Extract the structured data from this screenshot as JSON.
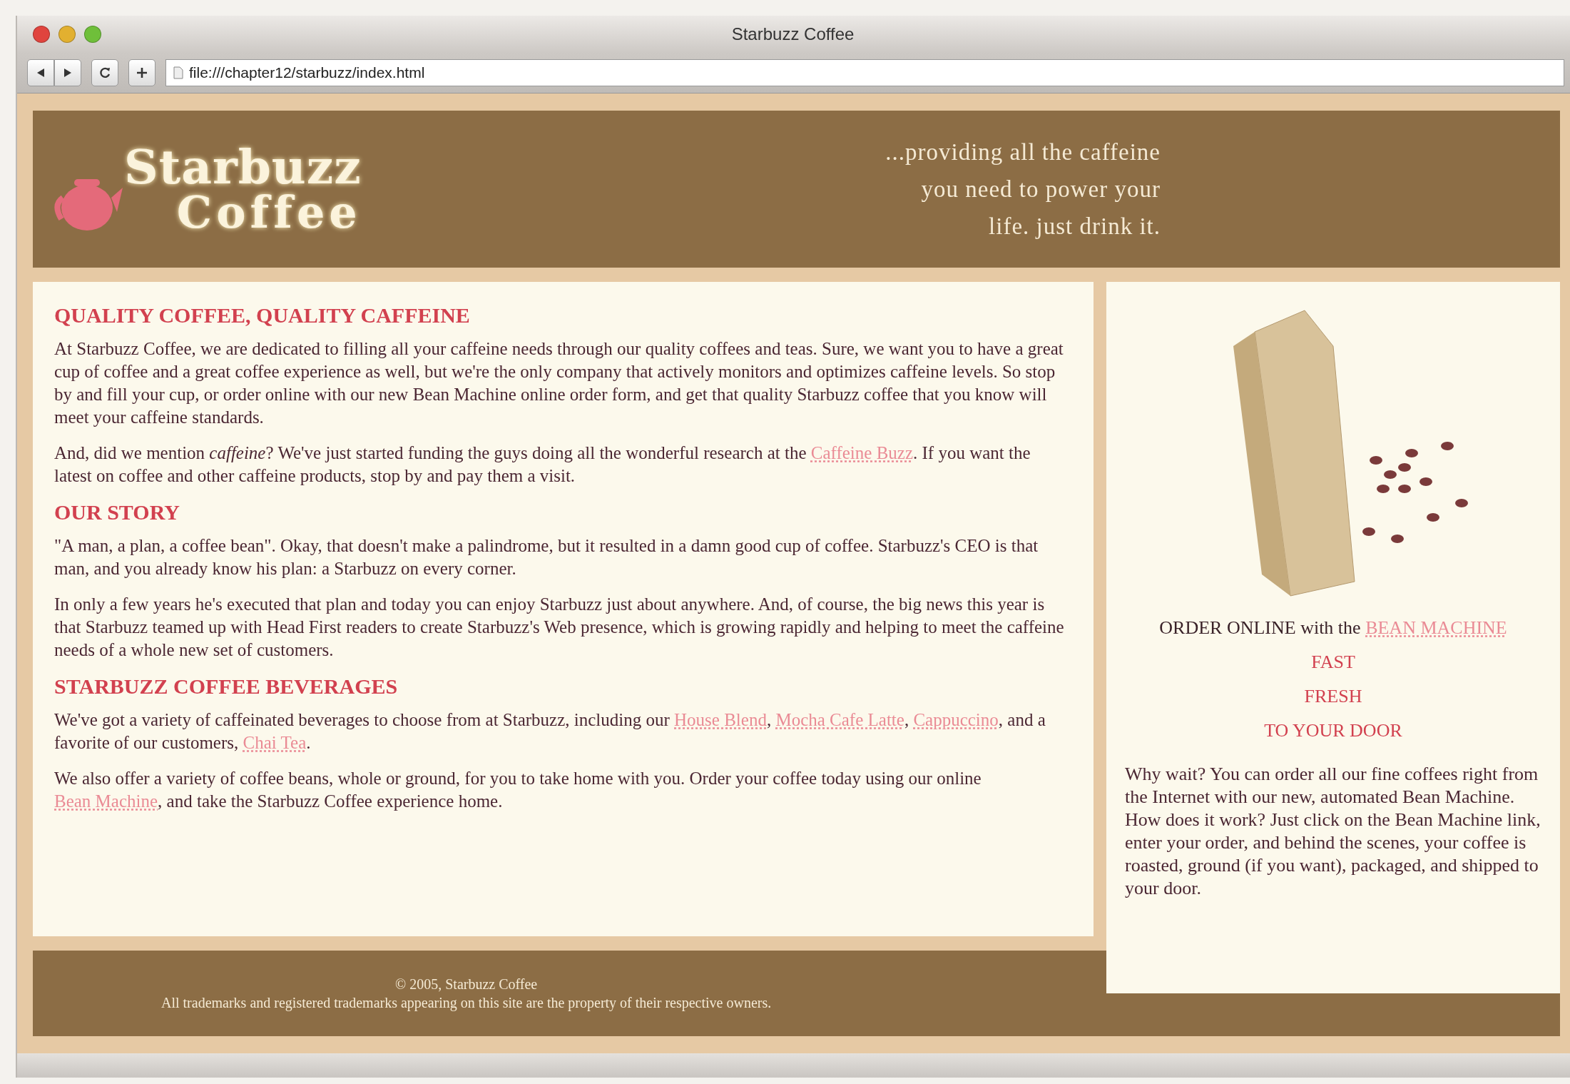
{
  "window": {
    "title": "Starbuzz Coffee",
    "url": "file:///chapter12/starbuzz/index.html"
  },
  "header": {
    "logo": [
      "Starbuzz",
      "Coffee"
    ],
    "tagline": [
      "...providing all the caffeine",
      "you need to power your",
      "life. just drink it."
    ]
  },
  "main": {
    "sections": [
      {
        "heading": "QUALITY COFFEE, QUALITY CAFFEINE",
        "paragraphs": [
          [
            {
              "kind": "text",
              "text": "At Starbuzz Coffee, we are dedicated to filling all your caffeine needs through our quality coffees and teas. Sure, we want you to have a great cup of coffee and a great coffee experience as well, but we're the only company that actively monitors and optimizes caffeine levels. So stop by and fill your cup, or order online with our new Bean Machine online order form, and get that quality Starbuzz coffee that you know will meet your caffeine standards."
            }
          ],
          [
            {
              "kind": "text",
              "text": "And, did we mention *caffeine*? We've just started funding the guys doing all the wonderful research at the "
            },
            {
              "kind": "link",
              "text": "Caffeine Buzz"
            },
            {
              "kind": "text",
              "text": ". If you want the latest on coffee and other caffeine products, stop by and pay them a visit."
            }
          ]
        ]
      },
      {
        "heading": "OUR STORY",
        "paragraphs": [
          [
            {
              "kind": "text",
              "text": "\"A man, a plan, a coffee bean\". Okay, that doesn't make a palindrome, but it resulted in a damn good cup of coffee. Starbuzz's CEO is that man, and you already know his plan: a Starbuzz on every corner."
            }
          ],
          [
            {
              "kind": "text",
              "text": "In only a few years he's executed that plan and today you can enjoy Starbuzz just about anywhere. And, of course, the big news this year is that Starbuzz teamed up with Head First readers to create Starbuzz's Web presence, which is growing rapidly and helping to meet the caffeine needs of a whole new set of customers."
            }
          ]
        ]
      },
      {
        "heading": "STARBUZZ COFFEE BEVERAGES",
        "paragraphs": [
          [
            {
              "kind": "text",
              "text": "We've got a variety of caffeinated beverages to choose from at Starbuzz, including our "
            },
            {
              "kind": "link",
              "text": "House Blend"
            },
            {
              "kind": "text",
              "text": ", "
            },
            {
              "kind": "link",
              "text": "Mocha Cafe Latte"
            },
            {
              "kind": "text",
              "text": ", "
            },
            {
              "kind": "link",
              "text": "Cappuccino"
            },
            {
              "kind": "text",
              "text": ", and a favorite of our customers, "
            },
            {
              "kind": "link",
              "text": "Chai Tea"
            },
            {
              "kind": "text",
              "text": "."
            }
          ],
          [
            {
              "kind": "text",
              "text": "We also offer a variety of coffee beans, whole or ground, for you to take home with you. Order your coffee today using our online "
            },
            {
              "kind": "link",
              "text": "Bean Machine"
            },
            {
              "kind": "text",
              "text": ", and take the Starbuzz Coffee experience home."
            }
          ]
        ]
      }
    ]
  },
  "sidebar": {
    "order": [
      {
        "kind": "text",
        "text": "ORDER ONLINE with the "
      },
      {
        "kind": "link",
        "text": "BEAN MACHINE"
      }
    ],
    "slogans": [
      "FAST",
      "FRESH",
      "TO YOUR DOOR"
    ],
    "paragraph": "Why wait? You can order all our fine coffees right from the Internet with our new, automated Bean Machine. How does it work? Just click on the Bean Machine link, enter your order, and behind the scenes, your coffee is roasted, ground (if you want), packaged, and shipped to your door."
  },
  "footer": [
    "© 2005, Starbuzz Coffee",
    "All trademarks and registered trademarks appearing on this site are the property of their respective owners."
  ]
}
